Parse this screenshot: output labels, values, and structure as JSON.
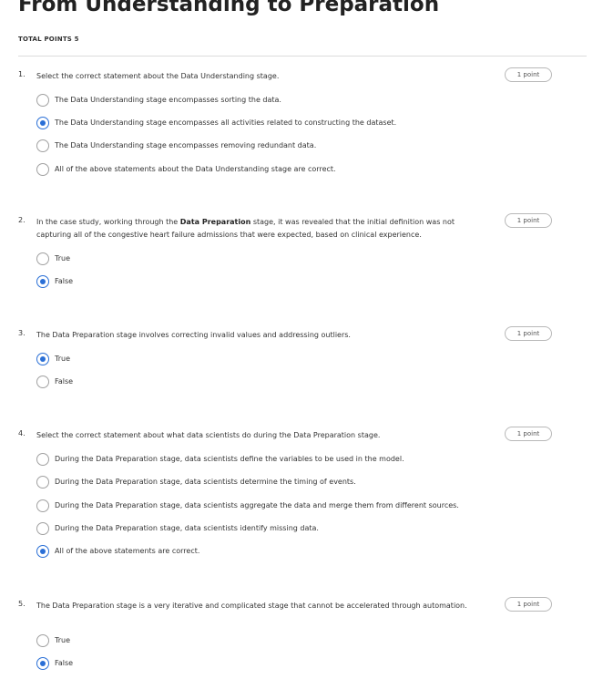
{
  "page": {
    "title": "From Understanding to Preparation",
    "total_points": "TOTAL POINTS 5"
  },
  "questions": [
    {
      "number": "1.",
      "text": "Select the correct statement about the Data Understanding stage.",
      "points": "1 point",
      "options": [
        {
          "label": "The Data Understanding stage encompasses sorting the data.",
          "selected": false
        },
        {
          "label": "The Data Understanding stage encompasses all activities related to constructing the dataset.",
          "selected": true
        },
        {
          "label": "The Data Understanding stage encompasses removing redundant data.",
          "selected": false
        },
        {
          "label": "All of the above statements about the Data Understanding stage are correct.",
          "selected": false
        }
      ]
    },
    {
      "number": "2.",
      "text_before": "In the case study, working through the ",
      "text_bold": "Data Preparation",
      "text_after": " stage, it was revealed that the initial definition was not capturing all of the congestive heart failure admissions that were expected, based on clinical experience.",
      "points": "1 point",
      "options": [
        {
          "label": "True",
          "selected": false
        },
        {
          "label": "False",
          "selected": true
        }
      ]
    },
    {
      "number": "3.",
      "text": "The Data Preparation stage involves correcting invalid values and addressing outliers.",
      "points": "1 point",
      "options": [
        {
          "label": "True",
          "selected": true
        },
        {
          "label": "False",
          "selected": false
        }
      ]
    },
    {
      "number": "4.",
      "text": "Select the correct statement about what data scientists do during the Data Preparation stage.",
      "points": "1 point",
      "options": [
        {
          "label": "During the Data Preparation stage, data scientists define the variables to be used in the model.",
          "selected": false
        },
        {
          "label": "During the Data Preparation stage, data scientists determine the timing of events.",
          "selected": false
        },
        {
          "label": "During the Data Preparation stage, data scientists aggregate the data and merge them from different sources.",
          "selected": false
        },
        {
          "label": "During the Data Preparation stage, data scientists identify missing data.",
          "selected": false
        },
        {
          "label": "All of the above statements are correct.",
          "selected": true
        }
      ]
    },
    {
      "number": "5.",
      "text": "The Data Preparation stage is a very iterative and complicated stage that cannot be accelerated through automation.",
      "points": "1 point",
      "options": [
        {
          "label": "True",
          "selected": false
        },
        {
          "label": "False",
          "selected": true
        }
      ]
    }
  ],
  "colors": {
    "accent": "#2a6fd6",
    "radio_border": "#a0a0a0",
    "pill_border": "#b8b8b8"
  }
}
